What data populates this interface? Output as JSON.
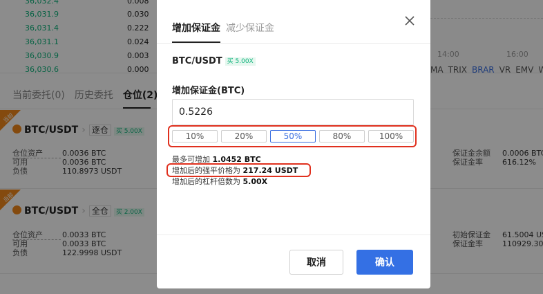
{
  "orderbook": [
    {
      "price": "36,032.4",
      "amount": "0.008"
    },
    {
      "price": "36,031.9",
      "amount": "0.030"
    },
    {
      "price": "36,031.4",
      "amount": "0.222"
    },
    {
      "price": "36,031.1",
      "amount": "0.024"
    },
    {
      "price": "36,030.9",
      "amount": "0.003"
    },
    {
      "price": "36,030.6",
      "amount": "0.000"
    }
  ],
  "chart": {
    "times": [
      "14:00",
      "16:00"
    ],
    "indicators": [
      "MA",
      "TRIX",
      "BRAR",
      "VR",
      "EMV",
      "W"
    ],
    "active_indicator": "BRAR"
  },
  "tabs": [
    "当前委托(0)",
    "历史委托",
    "仓位(2)"
  ],
  "active_tab": "仓位(2)",
  "positions": [
    {
      "tag": "当前",
      "pair": "BTC/USDT",
      "mode": "逐仓",
      "leverage": "买 5.00X",
      "left": [
        {
          "k": "仓位资产",
          "v": "0.0036 BTC"
        },
        {
          "k": "可用",
          "v": "0.0036 BTC"
        },
        {
          "k": "负债",
          "v": "110.8973 USDT"
        }
      ],
      "right": [
        {
          "k": "保证金余额",
          "v": "0.0006 BTC"
        },
        {
          "k": "保证金率",
          "v": "616.12%"
        }
      ]
    },
    {
      "tag": "当前",
      "pair": "BTC/USDT",
      "mode": "全仓",
      "leverage": "买 2.00X",
      "left": [
        {
          "k": "仓位资产",
          "v": "0.0033 BTC"
        },
        {
          "k": "可用",
          "v": "0.0033 BTC"
        },
        {
          "k": "负债",
          "v": "122.9998 USDT"
        }
      ],
      "right": [
        {
          "k": "初始保证金",
          "v": "61.5004 US"
        },
        {
          "k": "保证金率",
          "v": "110929.30"
        }
      ]
    }
  ],
  "modal": {
    "tabs": [
      "增加保证金",
      "减少保证金"
    ],
    "active_tab": "增加保证金",
    "pair": "BTC/USDT",
    "leverage": "买 5.00X",
    "field_label": "增加保证金(BTC)",
    "amount_value": "0.5226",
    "percent_options": [
      "10%",
      "20%",
      "50%",
      "80%",
      "100%"
    ],
    "selected_percent": "50%",
    "info": [
      {
        "label": "最多可增加",
        "value": "1.0452 BTC"
      },
      {
        "label": "增加后的强平价格为",
        "value": "217.24 USDT"
      },
      {
        "label": "增加后的杠杆倍数为",
        "value": "5.00X"
      }
    ],
    "cancel_label": "取消",
    "confirm_label": "确认"
  },
  "colors": {
    "accent": "#3470e4",
    "buy_green": "#0bb27a",
    "highlight_red": "#e0301e"
  }
}
